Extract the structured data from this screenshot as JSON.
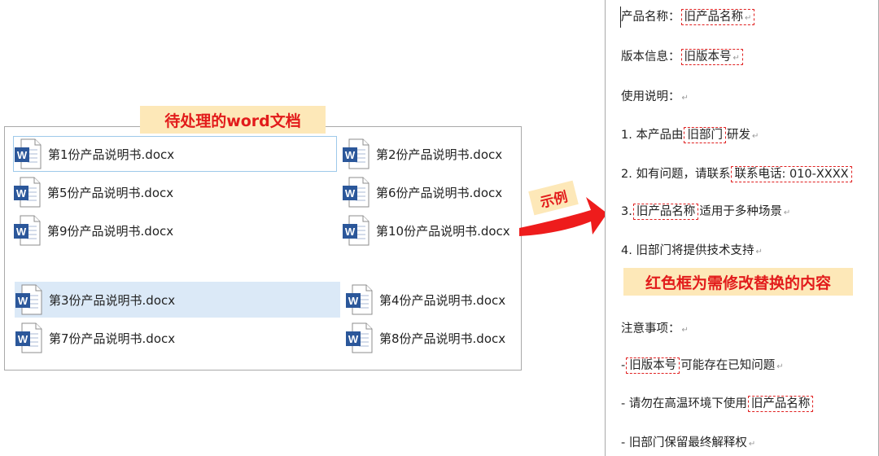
{
  "explorer": {
    "title": "待处理的word文档",
    "files": [
      {
        "name": "第1份产品说明书.docx"
      },
      {
        "name": "第2份产品说明书.docx"
      },
      {
        "name": "第5份产品说明书.docx"
      },
      {
        "name": "第6份产品说明书.docx"
      },
      {
        "name": "第9份产品说明书.docx"
      },
      {
        "name": "第10份产品说明书.docx"
      },
      {
        "name": "第3份产品说明书.docx"
      },
      {
        "name": "第4份产品说明书.docx"
      },
      {
        "name": "第7份产品说明书.docx"
      },
      {
        "name": "第8份产品说明书.docx"
      }
    ]
  },
  "arrow": {
    "label": "示例"
  },
  "doc": {
    "callout": "红色框为需修改替换的内容",
    "lines": {
      "l1": {
        "prefix": "产品名称：",
        "hl": "旧产品名称",
        "suffix": ""
      },
      "l2": {
        "prefix": "版本信息：",
        "hl": "旧版本号",
        "suffix": ""
      },
      "l3": {
        "text": "使用说明："
      },
      "l4": {
        "prefix": "1.  本产品由",
        "hl": "旧部门",
        "suffix": "研发"
      },
      "l5": {
        "prefix": "2.  如有问题，请联系",
        "hl": "联系电话: 010-XXXX",
        "suffix": ""
      },
      "l6": {
        "prefix": "3.",
        "hl": "旧产品名称",
        "suffix": "适用于多种场景"
      },
      "l7": {
        "text": "4.  旧部门将提供技术支持"
      },
      "l8": {
        "text": "注意事项："
      },
      "l9": {
        "prefix": "-",
        "hl": "旧版本号",
        "suffix": "可能存在已知问题"
      },
      "l10": {
        "prefix": "-  请勿在高温环境下使用",
        "hl": "旧产品名称",
        "suffix": ""
      },
      "l11": {
        "text": "-  旧部门保留最终解释权"
      }
    }
  },
  "colors": {
    "accent_red": "#e21b1b",
    "banner_bg": "#fde8b8",
    "selection_bg": "#dbe9f7",
    "word_blue": "#2b579a"
  }
}
